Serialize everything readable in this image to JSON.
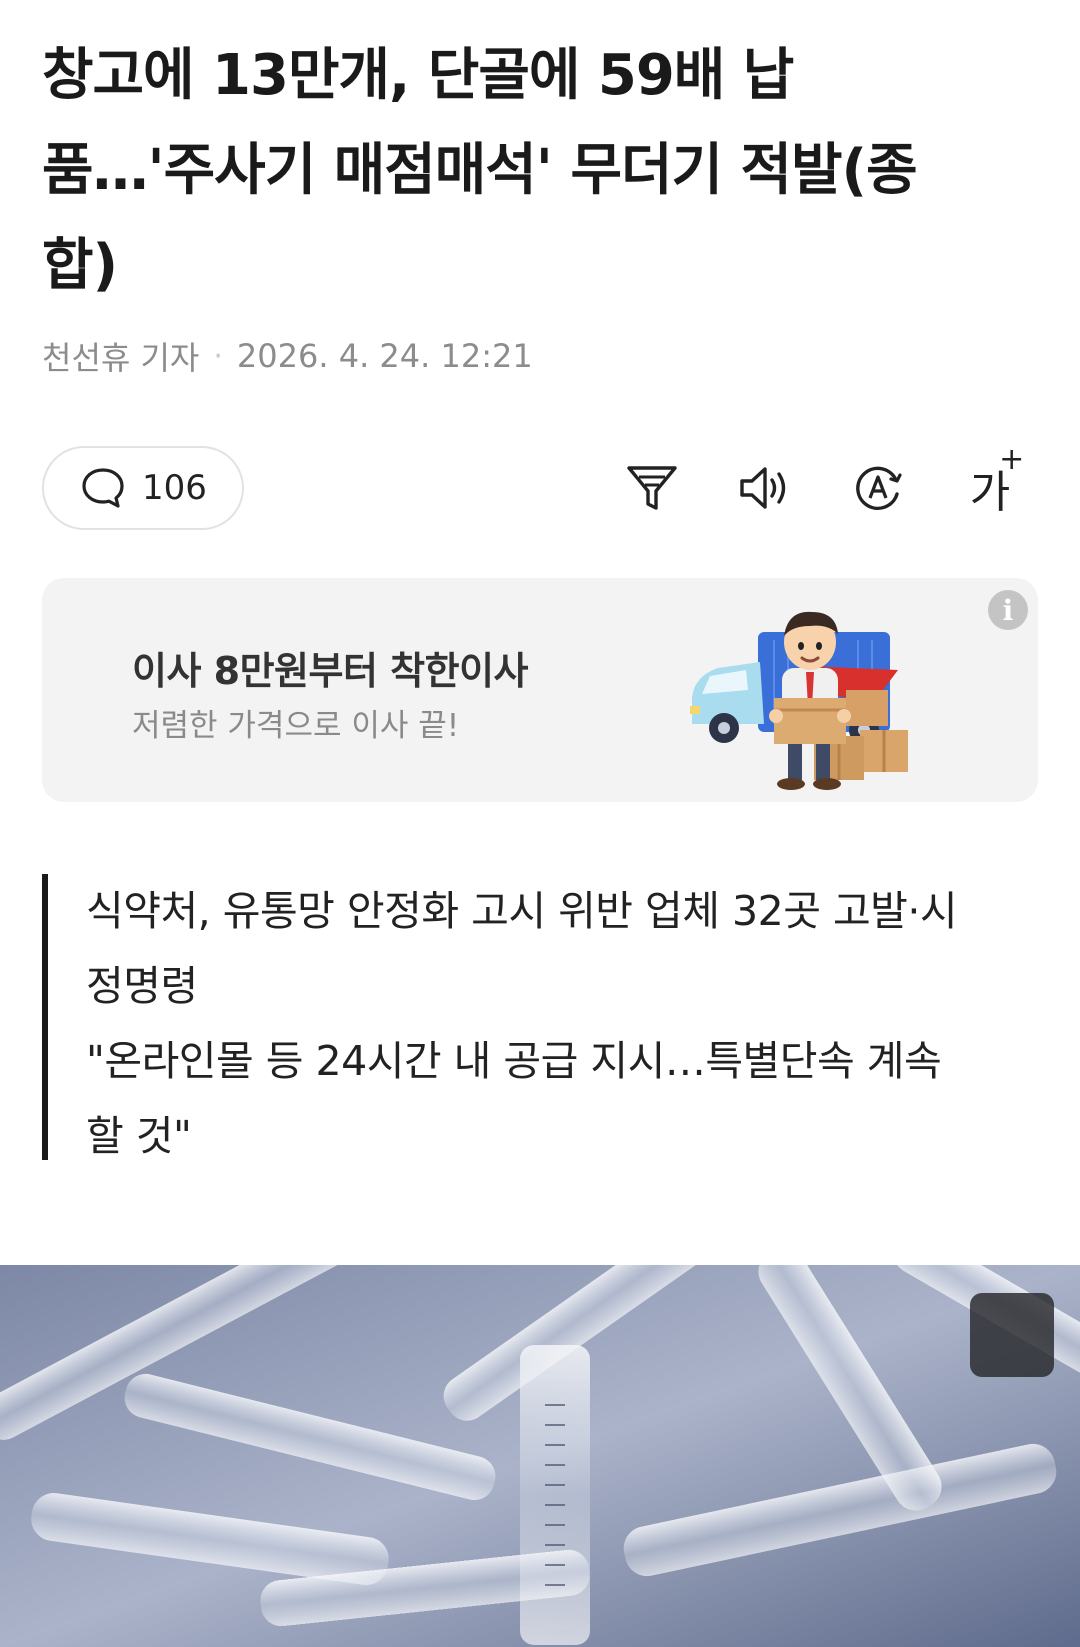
{
  "article": {
    "headline_line1": "창고에 13만개, 단골에 59배 납",
    "headline_line2": "품…'주사기 매점매석' 무더기 적발(종",
    "headline_line3": "합)",
    "author": "천선휴 기자",
    "separator": "·",
    "date": "2026. 4. 24. 12:21"
  },
  "toolbar": {
    "comment_count": "106",
    "font_size_glyph": "가",
    "font_size_plus": "+"
  },
  "ad": {
    "title": "이사 8만원부터 착한이사",
    "subtitle": "저렴한 가격으로 이사 끝!",
    "info_glyph": "i"
  },
  "summary": {
    "line1": "식약처, 유통망 안정화 고시 위반 업체 32곳 고발·시",
    "line2": "정명령",
    "line3": "\"온라인몰 등 24시간 내 공급 지시…특별단속 계속",
    "line4": "할 것\""
  },
  "colors": {
    "text": "#1a1a1a",
    "meta": "#8c8c8c",
    "ad_bg": "#f3f3f3",
    "photo_tint": "#5e6c8e"
  }
}
